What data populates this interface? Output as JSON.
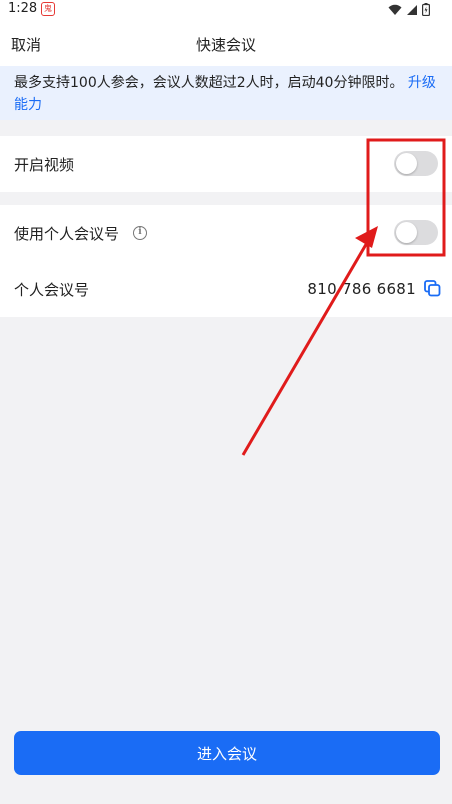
{
  "status_bar": {
    "time": "1:28",
    "app_icon_text": "鬼",
    "icons": [
      "wifi-icon",
      "signal-icon",
      "battery-icon"
    ]
  },
  "nav": {
    "cancel_label": "取消",
    "title": "快速会议"
  },
  "notice": {
    "text": "最多支持100人参会，会议人数超过2人时，启动40分钟限时。",
    "link_label": "升级能力"
  },
  "settings": {
    "video": {
      "label": "开启视频",
      "enabled": false
    },
    "personal_meeting_id": {
      "label": "使用个人会议号",
      "enabled": false,
      "info_icon": "info-icon"
    },
    "meeting_number": {
      "label": "个人会议号",
      "value": "810 786 6681",
      "icon": "copy-icon"
    }
  },
  "enter_button_label": "进入会议",
  "colors": {
    "accent": "#1a6cf5",
    "annotation": "#e01b1b",
    "notice_background": "#eaf1fe",
    "page_background": "#f2f2f4"
  }
}
